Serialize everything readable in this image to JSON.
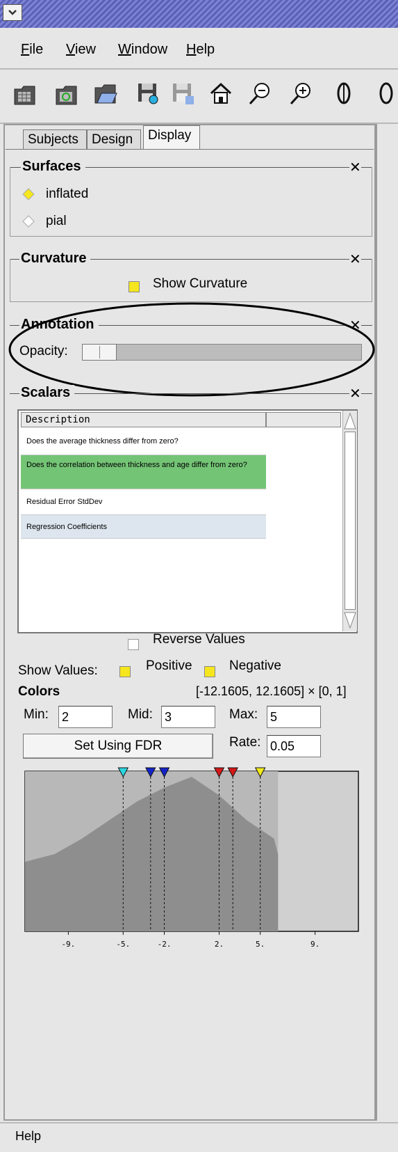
{
  "menubar": {
    "items": [
      "File",
      "View",
      "Window",
      "Help"
    ]
  },
  "toolbar": {
    "icons": [
      "new-subject-icon",
      "new-design-icon",
      "open-icon",
      "save-icon",
      "save-as-icon",
      "home-icon",
      "zoom-out-icon",
      "zoom-in-icon",
      "rotate-icon",
      "rotate-right-icon"
    ]
  },
  "tabs": [
    "Subjects",
    "Design",
    "Display"
  ],
  "active_tab": "Display",
  "surfaces": {
    "title": "Surfaces",
    "options": [
      "inflated",
      "pial"
    ],
    "selected": "inflated"
  },
  "curvature": {
    "title": "Curvature",
    "show_label": "Show Curvature",
    "checked": true
  },
  "annotation": {
    "title": "Annotation",
    "opacity_label": "Opacity:",
    "opacity": 0.1
  },
  "scalars": {
    "title": "Scalars",
    "column": "Description",
    "rows": [
      "Does the average thickness differ from zero?",
      "Does the correlation between thickness and age differ from zero?",
      "Residual Error StdDev",
      "Regression Coefficients"
    ],
    "selected_row": 1,
    "reverse_label": "Reverse Values",
    "show_values_label": "Show Values:",
    "positive_label": "Positive",
    "negative_label": "Negative"
  },
  "colors": {
    "title": "Colors",
    "range": "[-12.1605, 12.1605] × [0, 1]",
    "min_label": "Min:",
    "min": "2",
    "mid_label": "Mid:",
    "mid": "3",
    "max_label": "Max:",
    "max": "5",
    "fdr_button": "Set Using FDR",
    "rate_label": "Rate:",
    "rate": "0.05"
  },
  "chart_data": {
    "type": "area",
    "x_ticks": [
      "-9.",
      "-5.",
      "-2.",
      "2.",
      "5.",
      "9."
    ],
    "tick_values": [
      -9,
      -5,
      -2,
      2,
      5,
      9
    ],
    "xlim": [
      -12.1605,
      12.1605
    ],
    "markers": [
      {
        "x": -5,
        "color": "#2ad6e0"
      },
      {
        "x": -3,
        "color": "#1424c8"
      },
      {
        "x": -2,
        "color": "#1424c8"
      },
      {
        "x": 2,
        "color": "#d41818"
      },
      {
        "x": 3,
        "color": "#d41818"
      },
      {
        "x": 5,
        "color": "#f2ea1a"
      }
    ],
    "histogram_x": [
      -12.1605,
      -10,
      -8,
      -6,
      -4,
      -2,
      0,
      2,
      4,
      6,
      6.3
    ],
    "histogram_y": [
      0.45,
      0.5,
      0.6,
      0.72,
      0.84,
      0.93,
      1.0,
      0.88,
      0.72,
      0.6,
      0.5
    ],
    "highlight_range": [
      -12.1605,
      6.3
    ]
  },
  "statusbar": {
    "text": "Help"
  },
  "accent": {
    "selected_row": "#74c476",
    "row_alt": "#dde6ee",
    "check": "#f6e61e"
  }
}
